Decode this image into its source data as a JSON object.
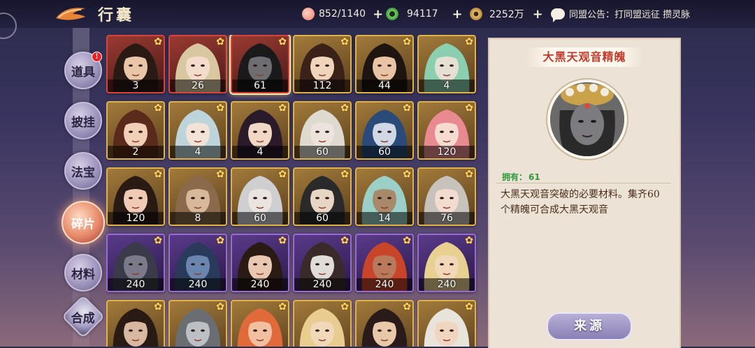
{
  "header": {
    "title": "行囊",
    "resources": [
      {
        "icon": "peach-icon",
        "value": "852/1140"
      },
      {
        "icon": "jade-icon",
        "value": "94117"
      },
      {
        "icon": "coin-icon",
        "value": "2252万"
      }
    ],
    "notice": "同盟公告：打同盟远征 攒灵脉"
  },
  "sidebar": {
    "items": [
      {
        "label": "道具",
        "badge": "!"
      },
      {
        "label": "披挂"
      },
      {
        "label": "法宝"
      },
      {
        "label": "碎片",
        "active": true
      },
      {
        "label": "材料"
      },
      {
        "label": "合成"
      }
    ]
  },
  "grid": {
    "rows": [
      [
        {
          "count": "3",
          "frame": "red"
        },
        {
          "count": "26",
          "frame": "red"
        },
        {
          "count": "61",
          "frame": "red",
          "selected": true
        },
        {
          "count": "112",
          "frame": "gold"
        },
        {
          "count": "44",
          "frame": "gold"
        },
        {
          "count": "4",
          "frame": "gold"
        }
      ],
      [
        {
          "count": "2",
          "frame": "gold"
        },
        {
          "count": "4",
          "frame": "gold"
        },
        {
          "count": "4",
          "frame": "gold"
        },
        {
          "count": "60",
          "frame": "gold"
        },
        {
          "count": "60",
          "frame": "gold"
        },
        {
          "count": "120",
          "frame": "gold"
        }
      ],
      [
        {
          "count": "120",
          "frame": "gold"
        },
        {
          "count": "8",
          "frame": "gold"
        },
        {
          "count": "60",
          "frame": "gold"
        },
        {
          "count": "60",
          "frame": "gold"
        },
        {
          "count": "14",
          "frame": "gold"
        },
        {
          "count": "76",
          "frame": "gold"
        }
      ],
      [
        {
          "count": "240",
          "frame": "purple"
        },
        {
          "count": "240",
          "frame": "purple"
        },
        {
          "count": "240",
          "frame": "purple"
        },
        {
          "count": "240",
          "frame": "purple"
        },
        {
          "count": "240",
          "frame": "purple"
        },
        {
          "count": "240",
          "frame": "purple"
        }
      ],
      [
        {
          "count": "",
          "frame": "gold"
        },
        {
          "count": "",
          "frame": "gold"
        },
        {
          "count": "",
          "frame": "gold"
        },
        {
          "count": "",
          "frame": "gold"
        },
        {
          "count": "",
          "frame": "gold"
        },
        {
          "count": "",
          "frame": "gold"
        }
      ]
    ]
  },
  "detail": {
    "name": "大黑天观音精魄",
    "owned_label": "拥有：",
    "owned_value": "61",
    "description": "大黑天观音突破的必要材料。集齐60个精魄可合成大黑天观音",
    "source_button": "来源"
  },
  "colors": {
    "gold_frame": "#e0b24a",
    "red_frame": "#d8443a",
    "purple_frame": "#9a6ad8",
    "title_red": "#c0392b",
    "owned_green": "#2f9a3a"
  }
}
